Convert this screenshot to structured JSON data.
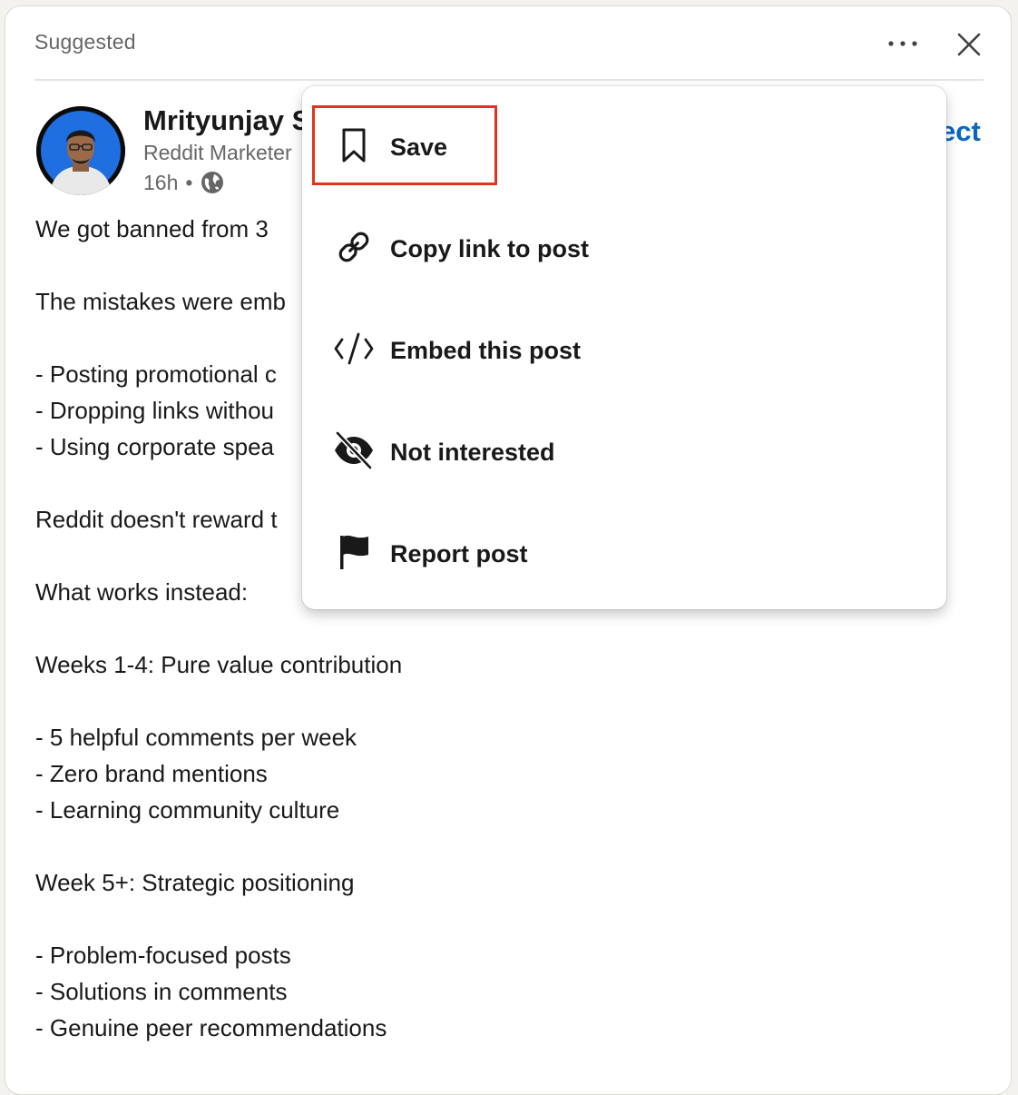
{
  "header": {
    "label": "Suggested",
    "more_icon": "more-horizontal-icon",
    "close_icon": "close-icon"
  },
  "author": {
    "name": "Mrityunjay S",
    "headline": "Reddit Marketer",
    "time": "16h",
    "separator": "•",
    "visibility_icon": "globe-icon",
    "connect_label": "ect"
  },
  "post": {
    "lines": [
      "We got banned from 3",
      "",
      "The mistakes were emb",
      "",
      "- Posting promotional c",
      "- Dropping links withou",
      "- Using corporate spea",
      "",
      "Reddit doesn't reward t",
      "",
      "What works instead:",
      "",
      "Weeks 1-4: Pure value contribution",
      "",
      "- 5 helpful comments per week",
      "- Zero brand mentions",
      "- Learning community culture",
      "",
      "Week 5+: Strategic positioning",
      "",
      "- Problem-focused posts",
      "- Solutions in comments",
      "- Genuine peer recommendations"
    ]
  },
  "menu": {
    "items": [
      {
        "label": "Save",
        "icon": "bookmark-icon"
      },
      {
        "label": "Copy link to post",
        "icon": "link-icon"
      },
      {
        "label": "Embed this post",
        "icon": "code-icon"
      },
      {
        "label": "Not interested",
        "icon": "eye-slash-icon"
      },
      {
        "label": "Report post",
        "icon": "flag-icon"
      }
    ],
    "highlighted_item": "Save"
  },
  "colors": {
    "accent": "#0a66c2",
    "highlight": "#e3331c",
    "avatar_ring": "#0a66c2"
  }
}
